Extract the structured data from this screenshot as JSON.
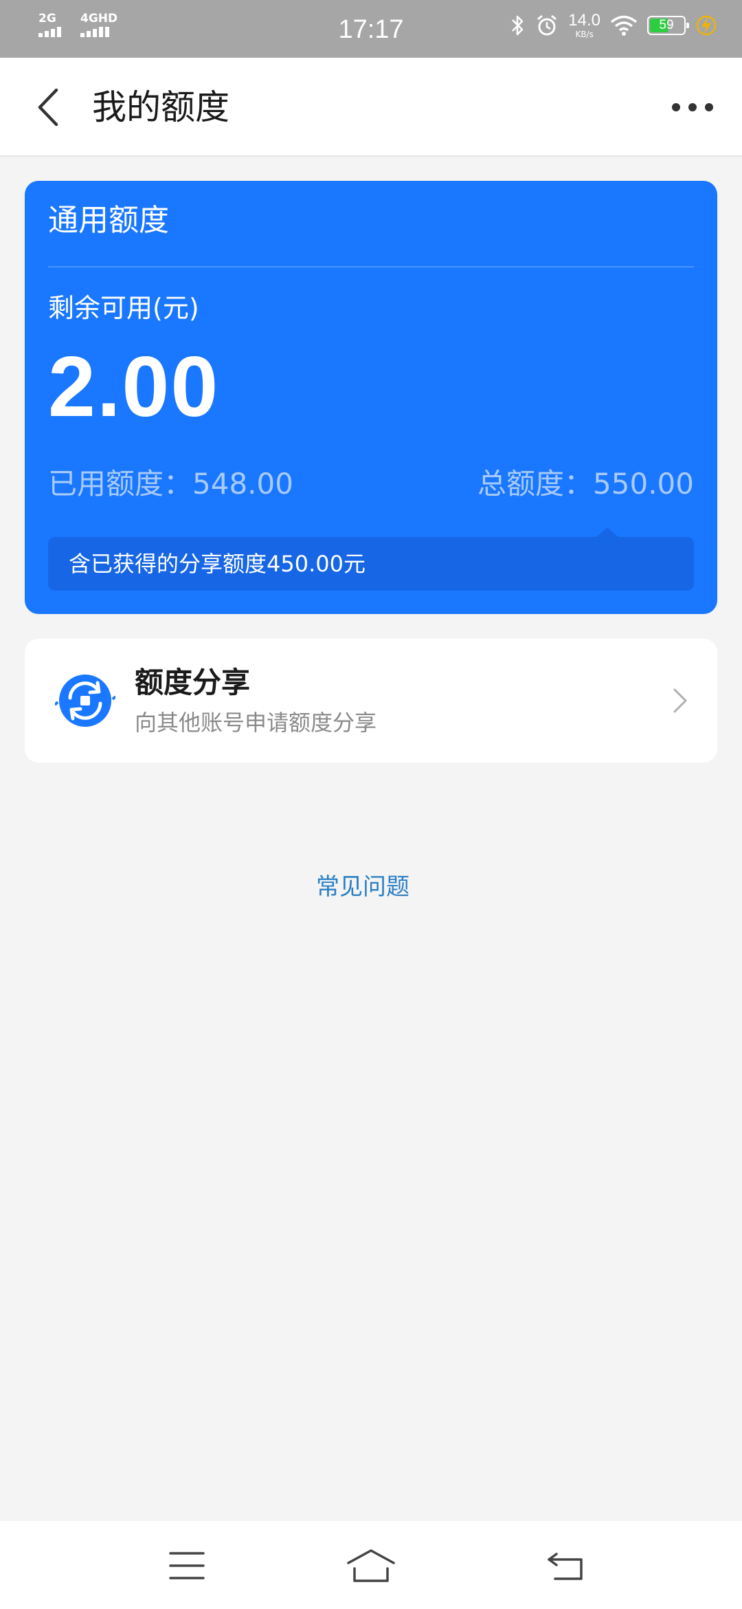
{
  "status_bar": {
    "signal_1": "2G",
    "signal_2": "4GHD",
    "time": "17:17",
    "speed_value": "14.0",
    "speed_unit": "KB/s",
    "battery_percent": "59",
    "icons": [
      "bluetooth-icon",
      "alarm-icon",
      "wifi-icon",
      "battery-icon",
      "charging-icon"
    ]
  },
  "app_bar": {
    "title": "我的额度",
    "back_icon": "chevron-left-icon",
    "more_icon": "more-dots-icon"
  },
  "quota_card": {
    "title": "通用额度",
    "remaining_label": "剩余可用(元)",
    "remaining_amount": "2.00",
    "used_text": "已用额度：548.00",
    "total_text": "总额度：550.00",
    "share_note": "含已获得的分享额度450.00元",
    "background_color": "#1a77ff"
  },
  "share_row": {
    "title": "额度分享",
    "subtitle": "向其他账号申请额度分享",
    "icon": "share-quota-icon",
    "chevron_icon": "chevron-right-icon"
  },
  "faq": {
    "label": "常见问题",
    "color": "#2a7fc4"
  },
  "nav_bar": {
    "icons": [
      "menu-icon",
      "home-icon",
      "back-icon"
    ]
  }
}
